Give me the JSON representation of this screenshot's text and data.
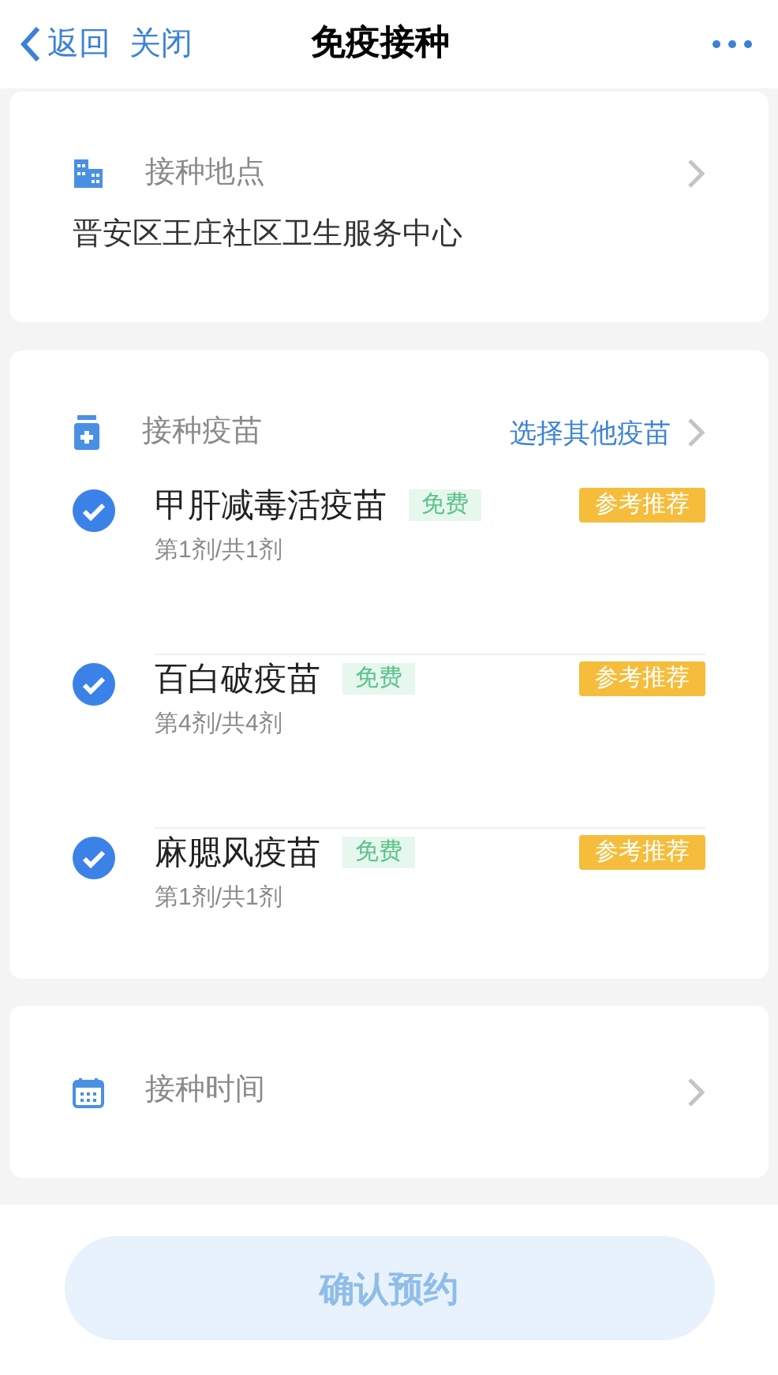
{
  "nav": {
    "back": "返回",
    "close": "关闭",
    "title": "免疫接种"
  },
  "location": {
    "label": "接种地点",
    "value": "晋安区王庄社区卫生服务中心"
  },
  "vaccines": {
    "label": "接种疫苗",
    "link": "选择其他疫苗",
    "items": [
      {
        "name": "甲肝减毒活疫苗",
        "tag": "免费",
        "dose": "第1剂/共1剂",
        "badge": "参考推荐",
        "checked": true
      },
      {
        "name": "百白破疫苗",
        "tag": "免费",
        "dose": "第4剂/共4剂",
        "badge": "参考推荐",
        "checked": true
      },
      {
        "name": "麻腮风疫苗",
        "tag": "免费",
        "dose": "第1剂/共1剂",
        "badge": "参考推荐",
        "checked": true
      }
    ]
  },
  "time": {
    "label": "接种时间"
  },
  "confirm": {
    "label": "确认预约",
    "disabled": true
  }
}
